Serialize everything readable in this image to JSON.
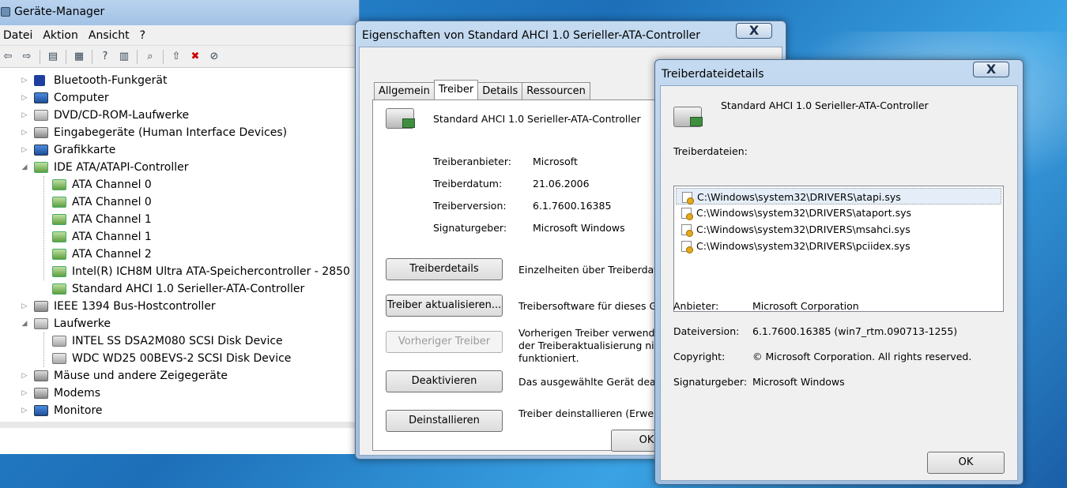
{
  "devmgr": {
    "title": "Geräte-Manager",
    "menu": [
      "Datei",
      "Aktion",
      "Ansicht",
      "?"
    ],
    "tree": [
      {
        "label": "Bluetooth-Funkgerät",
        "level": 0,
        "expanded": false,
        "icon": "bluetooth-icon"
      },
      {
        "label": "Computer",
        "level": 0,
        "expanded": false,
        "icon": "computer-icon"
      },
      {
        "label": "DVD/CD-ROM-Laufwerke",
        "level": 0,
        "expanded": false,
        "icon": "dvd-drive-icon"
      },
      {
        "label": "Eingabegeräte (Human Interface Devices)",
        "level": 0,
        "expanded": false,
        "icon": "hid-icon"
      },
      {
        "label": "Grafikkarte",
        "level": 0,
        "expanded": false,
        "icon": "display-adapter-icon"
      },
      {
        "label": "IDE ATA/ATAPI-Controller",
        "level": 0,
        "expanded": true,
        "icon": "ide-controller-icon"
      },
      {
        "label": "ATA Channel 0",
        "level": 1,
        "icon": "ide-controller-icon"
      },
      {
        "label": "ATA Channel 0",
        "level": 1,
        "icon": "ide-controller-icon"
      },
      {
        "label": "ATA Channel 1",
        "level": 1,
        "icon": "ide-controller-icon"
      },
      {
        "label": "ATA Channel 1",
        "level": 1,
        "icon": "ide-controller-icon"
      },
      {
        "label": "ATA Channel 2",
        "level": 1,
        "icon": "ide-controller-icon"
      },
      {
        "label": "Intel(R) ICH8M Ultra ATA-Speichercontroller - 2850",
        "level": 1,
        "icon": "ide-controller-icon"
      },
      {
        "label": "Standard AHCI 1.0 Serieller-ATA-Controller",
        "level": 1,
        "icon": "ide-controller-icon"
      },
      {
        "label": "IEEE 1394 Bus-Hostcontroller",
        "level": 0,
        "expanded": false,
        "icon": "firewire-icon"
      },
      {
        "label": "Laufwerke",
        "level": 0,
        "expanded": true,
        "icon": "disk-drive-icon"
      },
      {
        "label": "INTEL SS DSA2M080 SCSI Disk Device",
        "level": 1,
        "icon": "disk-drive-icon"
      },
      {
        "label": "WDC WD25 00BEVS-2 SCSI Disk Device",
        "level": 1,
        "icon": "disk-drive-icon"
      },
      {
        "label": "Mäuse und andere Zeigegeräte",
        "level": 0,
        "expanded": false,
        "icon": "mouse-icon"
      },
      {
        "label": "Modems",
        "level": 0,
        "expanded": false,
        "icon": "modem-icon"
      },
      {
        "label": "Monitore",
        "level": 0,
        "expanded": false,
        "icon": "monitor-icon"
      }
    ]
  },
  "props": {
    "title": "Eigenschaften von Standard AHCI 1.0 Serieller-ATA-Controller",
    "close": "X",
    "tabs": [
      "Allgemein",
      "Treiber",
      "Details",
      "Ressourcen"
    ],
    "active_tab": "Treiber",
    "device_name": "Standard AHCI 1.0 Serieller-ATA-Controller",
    "info": [
      {
        "label": "Treiberanbieter:",
        "value": "Microsoft"
      },
      {
        "label": "Treiberdatum:",
        "value": "21.06.2006"
      },
      {
        "label": "Treiberversion:",
        "value": "6.1.7600.16385"
      },
      {
        "label": "Signaturgeber:",
        "value": "Microsoft Windows"
      }
    ],
    "actions": [
      {
        "button": "Treiberdetails",
        "desc": "Einzelheiten über Treiberdate",
        "enabled": true
      },
      {
        "button": "Treiber aktualisieren...",
        "desc": "Treibersoftware für dieses Ge",
        "enabled": true
      },
      {
        "button": "Vorheriger Treiber",
        "desc": "Vorherigen Treiber verwende\nder Treiberaktualisierung nich\nfunktioniert.",
        "enabled": false
      },
      {
        "button": "Deaktivieren",
        "desc": "Das ausgewählte Gerät deakt",
        "enabled": true
      },
      {
        "button": "Deinstallieren",
        "desc": "Treiber deinstallieren (Erweite",
        "enabled": true
      }
    ],
    "ok": "OK"
  },
  "details": {
    "title": "Treiberdateidetails",
    "close": "X",
    "device_name": "Standard AHCI 1.0 Serieller-ATA-Controller",
    "files_label": "Treiberdateien:",
    "files": [
      "C:\\Windows\\system32\\DRIVERS\\atapi.sys",
      "C:\\Windows\\system32\\DRIVERS\\ataport.sys",
      "C:\\Windows\\system32\\DRIVERS\\msahci.sys",
      "C:\\Windows\\system32\\DRIVERS\\pciidex.sys"
    ],
    "selected_file": 0,
    "info": [
      {
        "label": "Anbieter:",
        "value": "Microsoft Corporation"
      },
      {
        "label": "Dateiversion:",
        "value": "6.1.7600.16385 (win7_rtm.090713-1255)"
      },
      {
        "label": "Copyright:",
        "value": "© Microsoft Corporation. All rights reserved."
      },
      {
        "label": "Signaturgeber:",
        "value": "Microsoft Windows"
      }
    ],
    "ok": "OK"
  }
}
